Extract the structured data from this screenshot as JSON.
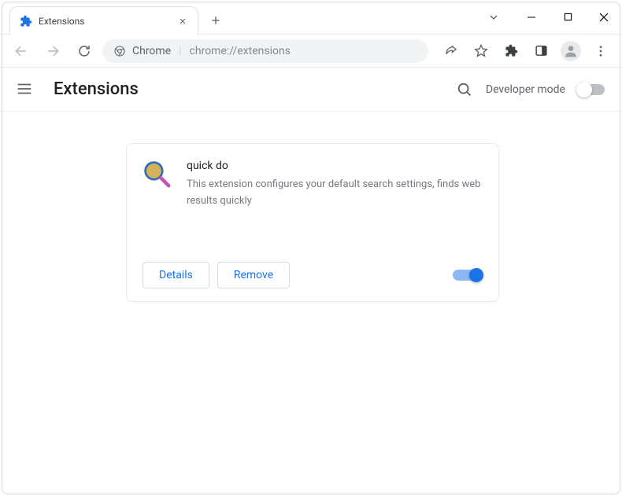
{
  "tab": {
    "title": "Extensions"
  },
  "omnibox": {
    "label": "Chrome",
    "url": "chrome://extensions"
  },
  "page": {
    "title": "Extensions",
    "dev_mode_label": "Developer mode"
  },
  "extension": {
    "name": "quick do",
    "description": "This extension configures your default search settings, finds web results quickly",
    "details_label": "Details",
    "remove_label": "Remove",
    "enabled": true
  },
  "colors": {
    "accent": "#1a73e8",
    "text_secondary": "#5f6368"
  }
}
